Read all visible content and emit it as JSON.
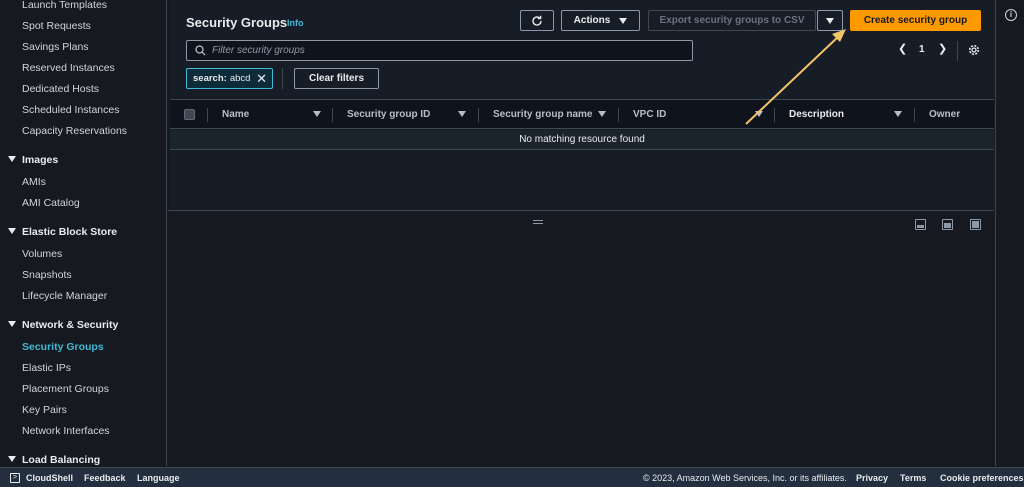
{
  "sidebar": {
    "items_top": [
      "Launch Templates",
      "Spot Requests",
      "Savings Plans",
      "Reserved Instances",
      "Dedicated Hosts",
      "Scheduled Instances",
      "Capacity Reservations"
    ],
    "sections": [
      {
        "label": "Images",
        "items": [
          "AMIs",
          "AMI Catalog"
        ]
      },
      {
        "label": "Elastic Block Store",
        "items": [
          "Volumes",
          "Snapshots",
          "Lifecycle Manager"
        ]
      },
      {
        "label": "Network & Security",
        "items": [
          "Security Groups",
          "Elastic IPs",
          "Placement Groups",
          "Key Pairs",
          "Network Interfaces"
        ]
      },
      {
        "label": "Load Balancing",
        "items": []
      }
    ],
    "active_item": "Security Groups"
  },
  "header": {
    "title": "Security Groups",
    "info": "Info",
    "actions_label": "Actions",
    "export_label": "Export security groups to CSV",
    "create_label": "Create security group"
  },
  "search": {
    "placeholder": "Filter security groups",
    "token_key": "search:",
    "token_value": "abcd",
    "clear_label": "Clear filters"
  },
  "pagination": {
    "page": "1"
  },
  "table": {
    "columns": [
      "Name",
      "Security group ID",
      "Security group name",
      "VPC ID",
      "Description",
      "Owner"
    ],
    "empty_message": "No matching resource found"
  },
  "footer": {
    "cloudshell": "CloudShell",
    "feedback": "Feedback",
    "language": "Language",
    "copyright": "© 2023, Amazon Web Services, Inc. or its affiliates.",
    "privacy": "Privacy",
    "terms": "Terms",
    "cookies": "Cookie preferences"
  },
  "colors": {
    "accent": "#ff9900",
    "link": "#44b9d6",
    "annotation": "#f5c469"
  }
}
